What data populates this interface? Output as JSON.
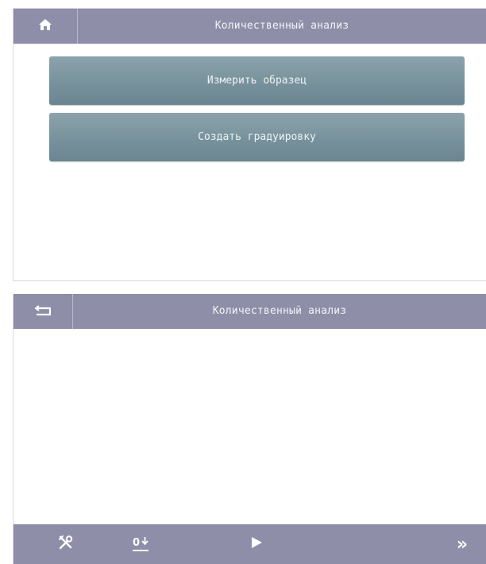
{
  "screen_top": {
    "title": "Количественный анализ",
    "home_icon": "home-icon",
    "buttons": [
      {
        "label": "Измерить образец"
      },
      {
        "label": "Создать градуировку"
      }
    ]
  },
  "screen_bottom": {
    "title": "Количественный анализ",
    "back_icon": "back-icon",
    "toolbar": {
      "tools_icon": "tools-icon",
      "zero_label": "0",
      "play_icon": "play-icon",
      "next_label": "»"
    }
  },
  "colors": {
    "titlebar": "#8e8ea8",
    "button": "#7b959f",
    "text_light": "#f4f4f8"
  }
}
